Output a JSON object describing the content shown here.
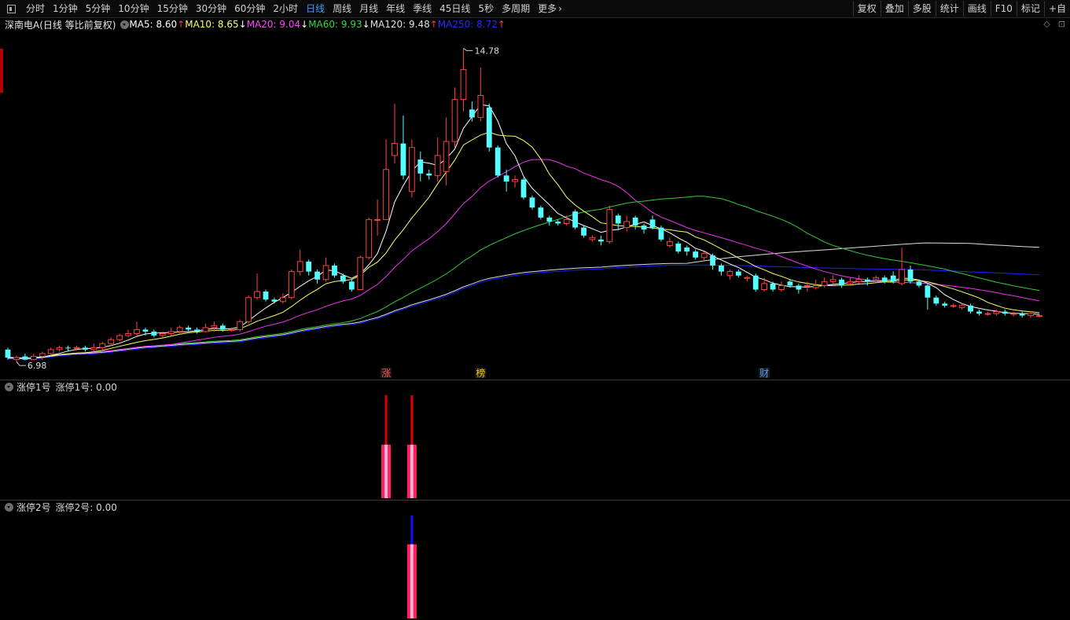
{
  "toolbar": {
    "periods": [
      "分时",
      "1分钟",
      "5分钟",
      "10分钟",
      "15分钟",
      "30分钟",
      "60分钟",
      "2小时",
      "日线",
      "周线",
      "月线",
      "年线",
      "季线",
      "45日线",
      "5秒",
      "多周期",
      "更多"
    ],
    "active_period": "日线",
    "right_buttons": [
      "复权",
      "叠加",
      "多股",
      "统计",
      "画线",
      "F10",
      "标记",
      "+自"
    ]
  },
  "legend": {
    "stock_name": "深南电A(日线 等比前复权)",
    "ma": [
      {
        "label": "MA5: 8.60",
        "arrow": "↑",
        "color": "#ffffff",
        "arrow_color": "#ff3b3b"
      },
      {
        "label": "MA10: 8.65",
        "arrow": "↓",
        "color": "#ffff66",
        "arrow_color": "#ffffff"
      },
      {
        "label": "MA20: 9.04",
        "arrow": "↓",
        "color": "#ff44ff",
        "arrow_color": "#ffffff"
      },
      {
        "label": "MA60: 9.93",
        "arrow": "↓",
        "color": "#33dd33",
        "arrow_color": "#ffffff"
      },
      {
        "label": "MA120: 9.48",
        "arrow": "↑",
        "color": "#e0e0e0",
        "arrow_color": "#ff3b3b"
      },
      {
        "label": "MA250: 8.72",
        "arrow": "↑",
        "color": "#2a2aff",
        "arrow_color": "#ff3b3b"
      }
    ]
  },
  "right_icons": [
    "◇",
    "⊡"
  ],
  "indicator1": {
    "name": "涨停1号",
    "value_label": "涨停1号: 0.00"
  },
  "indicator2": {
    "name": "涨停2号",
    "value_label": "涨停2号: 0.00"
  },
  "colors": {
    "up": "#ff4040",
    "down": "#54ffff",
    "ma5": "#ffffff",
    "ma10": "#ffff66",
    "ma20": "#ee33ee",
    "ma60": "#33cc33",
    "ma120": "#dddddd",
    "ma250": "#2222ff"
  },
  "chart_data": {
    "type": "candlestick",
    "ylim": [
      6.6,
      15.2
    ],
    "high_label": "14.78",
    "low_label": "6.98",
    "annotations": [
      "涨",
      "榜",
      "财"
    ],
    "candles": [
      [
        7.25,
        7.05,
        7.3,
        7.0
      ],
      [
        7.0,
        7.05,
        7.1,
        6.95
      ],
      [
        7.08,
        7.0,
        7.15,
        6.98
      ],
      [
        7.0,
        7.08,
        7.15,
        6.98
      ],
      [
        7.08,
        7.15,
        7.2,
        7.0
      ],
      [
        7.15,
        7.25,
        7.3,
        7.1
      ],
      [
        7.25,
        7.3,
        7.35,
        7.2
      ],
      [
        7.3,
        7.28,
        7.35,
        7.2
      ],
      [
        7.28,
        7.3,
        7.35,
        7.22
      ],
      [
        7.3,
        7.25,
        7.35,
        7.2
      ],
      [
        7.25,
        7.3,
        7.4,
        7.2
      ],
      [
        7.3,
        7.4,
        7.45,
        7.25
      ],
      [
        7.4,
        7.5,
        7.55,
        7.35
      ],
      [
        7.5,
        7.6,
        7.65,
        7.45
      ],
      [
        7.6,
        7.65,
        7.75,
        7.55
      ],
      [
        7.65,
        7.75,
        7.95,
        7.6
      ],
      [
        7.75,
        7.7,
        7.8,
        7.6
      ],
      [
        7.7,
        7.6,
        7.75,
        7.55
      ],
      [
        7.6,
        7.65,
        7.7,
        7.55
      ],
      [
        7.65,
        7.7,
        7.8,
        7.6
      ],
      [
        7.7,
        7.8,
        7.85,
        7.65
      ],
      [
        7.8,
        7.75,
        7.85,
        7.7
      ],
      [
        7.75,
        7.7,
        7.8,
        7.65
      ],
      [
        7.7,
        7.8,
        7.9,
        7.68
      ],
      [
        7.8,
        7.85,
        7.95,
        7.7
      ],
      [
        7.85,
        7.75,
        7.9,
        7.7
      ],
      [
        7.75,
        7.75,
        7.8,
        7.7
      ],
      [
        7.75,
        7.95,
        8.0,
        7.7
      ],
      [
        7.95,
        8.55,
        8.6,
        7.9
      ],
      [
        8.55,
        8.7,
        9.15,
        8.5
      ],
      [
        8.7,
        8.5,
        8.75,
        8.45
      ],
      [
        8.5,
        8.45,
        8.55,
        8.4
      ],
      [
        8.45,
        8.55,
        8.65,
        8.4
      ],
      [
        8.55,
        9.2,
        9.25,
        8.5
      ],
      [
        9.2,
        9.45,
        9.75,
        9.1
      ],
      [
        9.45,
        9.2,
        9.5,
        9.1
      ],
      [
        9.2,
        9.0,
        9.25,
        8.9
      ],
      [
        9.0,
        9.35,
        9.55,
        8.95
      ],
      [
        9.35,
        9.1,
        9.4,
        9.05
      ],
      [
        9.1,
        8.95,
        9.15,
        8.9
      ],
      [
        8.95,
        8.75,
        9.0,
        8.7
      ],
      [
        8.75,
        9.55,
        9.6,
        8.75
      ],
      [
        9.55,
        10.5,
        10.55,
        9.5
      ],
      [
        10.5,
        10.5,
        11.0,
        10.1
      ],
      [
        10.5,
        11.75,
        12.5,
        10.5
      ],
      [
        12.1,
        12.4,
        13.4,
        11.9
      ],
      [
        12.4,
        11.6,
        13.1,
        11.5
      ],
      [
        11.2,
        12.3,
        12.5,
        11.05
      ],
      [
        12.0,
        11.65,
        12.2,
        11.45
      ],
      [
        11.65,
        11.6,
        11.75,
        11.5
      ],
      [
        11.6,
        12.1,
        12.55,
        11.45
      ],
      [
        11.7,
        12.45,
        13.05,
        11.35
      ],
      [
        12.45,
        13.5,
        13.8,
        12.3
      ],
      [
        13.5,
        14.25,
        14.78,
        13.2
      ],
      [
        13.25,
        13.05,
        13.45,
        12.95
      ],
      [
        13.05,
        13.6,
        14.3,
        12.95
      ],
      [
        13.3,
        12.3,
        13.4,
        12.2
      ],
      [
        12.3,
        11.6,
        12.35,
        11.55
      ],
      [
        11.6,
        11.45,
        11.75,
        11.2
      ],
      [
        11.45,
        11.5,
        11.6,
        11.3
      ],
      [
        11.5,
        11.05,
        11.55,
        11.0
      ],
      [
        11.05,
        10.8,
        11.1,
        10.75
      ],
      [
        10.8,
        10.55,
        10.85,
        10.5
      ],
      [
        10.55,
        10.45,
        10.6,
        10.35
      ],
      [
        10.45,
        10.4,
        10.5,
        10.35
      ],
      [
        10.4,
        10.5,
        10.6,
        10.35
      ],
      [
        10.7,
        10.3,
        10.75,
        10.25
      ],
      [
        10.3,
        10.1,
        10.35,
        10.05
      ],
      [
        10.0,
        10.05,
        10.1,
        9.95
      ],
      [
        10.0,
        9.95,
        10.1,
        9.85
      ],
      [
        9.95,
        10.75,
        10.85,
        9.9
      ],
      [
        10.6,
        10.4,
        10.65,
        10.25
      ],
      [
        10.3,
        10.45,
        10.6,
        10.2
      ],
      [
        10.55,
        10.35,
        10.6,
        10.25
      ],
      [
        10.35,
        10.25,
        10.4,
        10.15
      ],
      [
        10.5,
        10.3,
        10.6,
        10.25
      ],
      [
        10.3,
        10.0,
        10.35,
        9.95
      ],
      [
        9.85,
        9.95,
        10.05,
        9.8
      ],
      [
        9.9,
        9.7,
        9.95,
        9.65
      ],
      [
        9.8,
        9.7,
        9.85,
        9.6
      ],
      [
        9.7,
        9.55,
        9.75,
        9.5
      ],
      [
        9.55,
        9.65,
        9.7,
        9.45
      ],
      [
        9.6,
        9.35,
        9.65,
        9.25
      ],
      [
        9.35,
        9.2,
        9.4,
        9.1
      ],
      [
        9.1,
        9.2,
        9.25,
        9.0
      ],
      [
        9.2,
        9.1,
        9.25,
        9.05
      ],
      [
        9.05,
        9.05,
        9.1,
        8.95
      ],
      [
        9.1,
        8.75,
        9.15,
        8.7
      ],
      [
        8.75,
        8.9,
        9.05,
        8.7
      ],
      [
        8.9,
        8.75,
        8.95,
        8.7
      ],
      [
        8.75,
        8.85,
        8.95,
        8.7
      ],
      [
        8.95,
        8.85,
        9.0,
        8.8
      ],
      [
        8.85,
        8.75,
        8.9,
        8.65
      ],
      [
        8.85,
        8.85,
        8.95,
        8.7
      ],
      [
        8.8,
        8.85,
        9.0,
        8.75
      ],
      [
        8.85,
        8.95,
        9.05,
        8.8
      ],
      [
        8.95,
        9.0,
        9.1,
        8.9
      ],
      [
        9.0,
        8.85,
        9.05,
        8.8
      ],
      [
        8.9,
        8.95,
        9.05,
        8.85
      ],
      [
        8.95,
        9.0,
        9.1,
        8.9
      ],
      [
        9.0,
        8.95,
        9.05,
        8.85
      ],
      [
        9.0,
        9.05,
        9.1,
        8.95
      ],
      [
        9.05,
        8.95,
        9.1,
        8.9
      ],
      [
        9.1,
        8.95,
        9.2,
        8.9
      ],
      [
        8.9,
        9.25,
        9.8,
        8.85
      ],
      [
        9.25,
        8.95,
        9.35,
        8.9
      ],
      [
        8.95,
        8.85,
        9.0,
        8.8
      ],
      [
        8.85,
        8.55,
        8.9,
        8.25
      ],
      [
        8.55,
        8.4,
        8.6,
        8.35
      ],
      [
        8.4,
        8.35,
        8.45,
        8.3
      ],
      [
        8.35,
        8.35,
        8.4,
        8.3
      ],
      [
        8.3,
        8.35,
        8.4,
        8.25
      ],
      [
        8.35,
        8.2,
        8.4,
        8.15
      ],
      [
        8.2,
        8.15,
        8.25,
        8.1
      ],
      [
        8.15,
        8.15,
        8.2,
        8.1
      ],
      [
        8.15,
        8.2,
        8.25,
        8.1
      ],
      [
        8.2,
        8.15,
        8.25,
        8.1
      ],
      [
        8.15,
        8.15,
        8.2,
        8.08
      ],
      [
        8.15,
        8.1,
        8.2,
        8.05
      ],
      [
        8.1,
        8.15,
        8.2,
        8.05
      ],
      [
        8.1,
        8.1,
        8.15,
        8.05
      ]
    ],
    "indicator1_bars": [
      {
        "index": 44,
        "tall": 1.0,
        "base": 0.52
      },
      {
        "index": 47,
        "tall": 1.0,
        "base": 0.52
      }
    ],
    "indicator2_bars": [
      {
        "index": 47,
        "tall": 1.0,
        "base": 0.72
      }
    ]
  }
}
